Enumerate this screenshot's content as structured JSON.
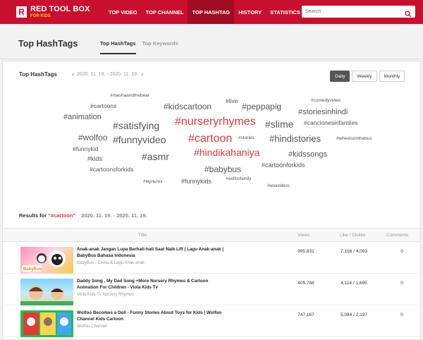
{
  "brand": {
    "logo_mark": "R",
    "title": "RED TOOL BOX",
    "subtitle": "FOR KIDS"
  },
  "nav": [
    {
      "label": "TOP VIDEO",
      "active": false
    },
    {
      "label": "TOP CHANNEL",
      "active": false
    },
    {
      "label": "TOP HASHTAG",
      "active": true
    },
    {
      "label": "HISTORY",
      "active": false
    },
    {
      "label": "STATISTICS",
      "active": false
    }
  ],
  "search": {
    "placeholder": "Search",
    "icon": "search-icon"
  },
  "page": {
    "title": "Top HashTags",
    "tabs": [
      {
        "label": "Top HashTags",
        "active": true
      },
      {
        "label": "Top Keywords",
        "active": false
      }
    ]
  },
  "panel": {
    "title": "Top HashTags",
    "date_range": "2020. 11. 19. - 2020. 11. 19.",
    "periods": [
      {
        "label": "Daily",
        "active": true
      },
      {
        "label": "Weekly",
        "active": false
      },
      {
        "label": "Monthly",
        "active": false
      }
    ]
  },
  "tags": [
    {
      "text": "#mashaandthebear",
      "emphasis": "small",
      "highlight": false
    },
    {
      "text": "#cartoons",
      "emphasis": "medium",
      "highlight": false
    },
    {
      "text": "#kidscartoon",
      "emphasis": "large",
      "highlight": false
    },
    {
      "text": "#live",
      "emphasis": "medium",
      "highlight": false
    },
    {
      "text": "#peppapig",
      "emphasis": "large",
      "highlight": false
    },
    {
      "text": "#comedyvideo",
      "emphasis": "small",
      "highlight": false
    },
    {
      "text": "#animation",
      "emphasis": "large",
      "highlight": false
    },
    {
      "text": "#storiesinhindi",
      "emphasis": "large",
      "highlight": false
    },
    {
      "text": "#satisfying",
      "emphasis": "xlarge",
      "highlight": false
    },
    {
      "text": "#nurseryrhymes",
      "emphasis": "xlarge",
      "highlight": true
    },
    {
      "text": "#slime",
      "emphasis": "xlarge",
      "highlight": false
    },
    {
      "text": "#cancionesinfantiles",
      "emphasis": "medium",
      "highlight": false
    },
    {
      "text": "#wolfoo",
      "emphasis": "large",
      "highlight": false
    },
    {
      "text": "#funnyvideo",
      "emphasis": "xlarge",
      "highlight": false
    },
    {
      "text": "#cartoon",
      "emphasis": "xlarge",
      "highlight": true
    },
    {
      "text": "#stories",
      "emphasis": "small",
      "highlight": false
    },
    {
      "text": "#hindistories",
      "emphasis": "large",
      "highlight": false
    },
    {
      "text": "#wheelsonthebus",
      "emphasis": "small",
      "highlight": false
    },
    {
      "text": "#funnykid",
      "emphasis": "medium",
      "highlight": false
    },
    {
      "text": "#asmr",
      "emphasis": "xlarge",
      "highlight": false
    },
    {
      "text": "#hindikahaniya",
      "emphasis": "xlarge",
      "highlight": true
    },
    {
      "text": "#kidssongs",
      "emphasis": "large",
      "highlight": false
    },
    {
      "text": "#kids",
      "emphasis": "medium",
      "highlight": false
    },
    {
      "text": "#cartoonforkids",
      "emphasis": "medium",
      "highlight": false
    },
    {
      "text": "#cartoonsforkids",
      "emphasis": "medium",
      "highlight": false
    },
    {
      "text": "#babybus",
      "emphasis": "large",
      "highlight": false
    },
    {
      "text": "#мультик",
      "emphasis": "small",
      "highlight": false
    },
    {
      "text": "#funnykids",
      "emphasis": "medium",
      "highlight": false
    },
    {
      "text": "#wolfoofamily",
      "emphasis": "small",
      "highlight": false
    },
    {
      "text": "#woavideos",
      "emphasis": "small",
      "highlight": false
    }
  ],
  "results": {
    "prefix": "Results for",
    "query": "\"#cartoon\"",
    "date_range": "2020. 11. 19. - 2020. 11. 19.",
    "columns": {
      "title": "Title",
      "views": "Views",
      "likes": "Like / Dislike",
      "comments": "Comments"
    },
    "rows": [
      {
        "title": "Anak-anak Jangan Lupa Berhati-hati Saat Naik Lift | Lagu Anak-anak | BabyBus Bahasa Indonesia",
        "channel": "BabyBus - Cerita & Lagu Anak-anak",
        "views": "995,831",
        "likes": "7,156 / 4,093",
        "comments": "0",
        "thumb_caption": "BabyBus"
      },
      {
        "title": "Daddy Song , My Dad Song +More Nursery Rhymes & Cartoon Animation For Children - Viola Kids Tv",
        "channel": "Viola Kids Tv Nursery Rhymes",
        "views": "405,788",
        "likes": "4,114 / 1,695",
        "comments": "0",
        "thumb_caption": ""
      },
      {
        "title": "Wolfoo Becomes a Doll - Funny Stories About Toys for Kids | Wolfoo Channel Kids Cartoon",
        "channel": "Wolfoo Channel",
        "views": "747,167",
        "likes": "5,084 / 2,197",
        "comments": "0",
        "thumb_caption": ""
      }
    ]
  }
}
